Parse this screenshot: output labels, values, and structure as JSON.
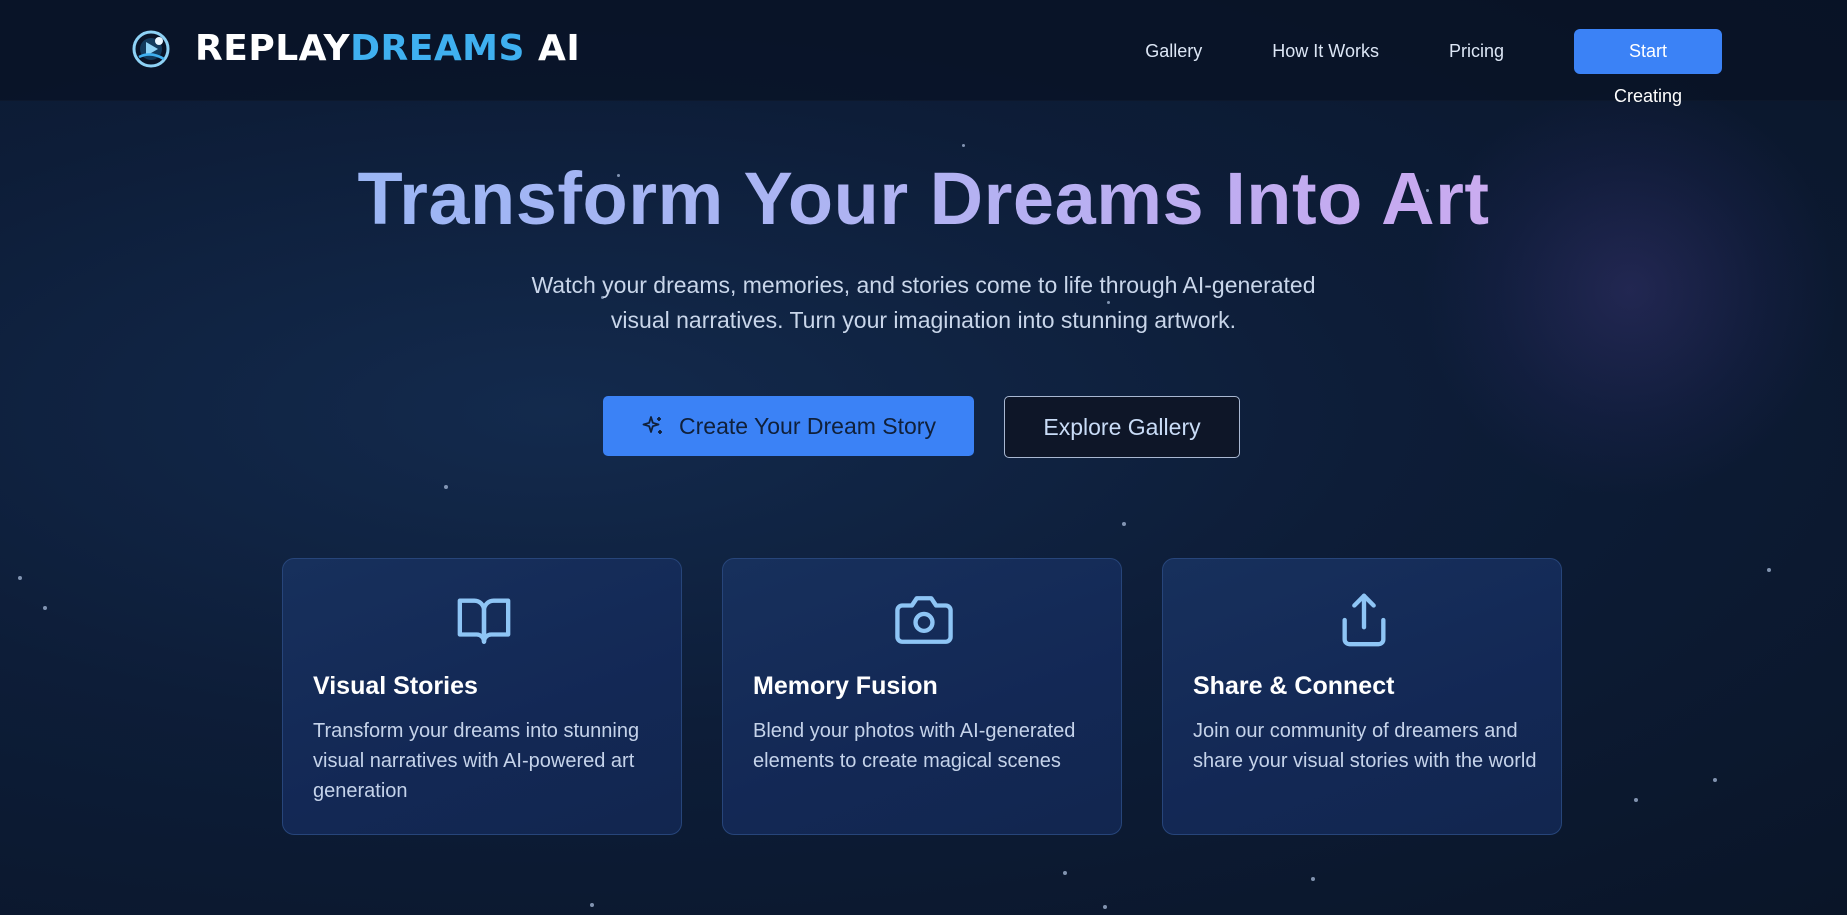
{
  "brand": {
    "part1": "REPLAY",
    "part2": "DREAMS",
    "part3": " AI"
  },
  "nav": {
    "items": [
      "Gallery",
      "How It Works",
      "Pricing"
    ],
    "cta": "Start Creating"
  },
  "hero": {
    "title": "Transform Your Dreams Into Art",
    "subtitle": "Watch your dreams, memories, and stories come to life through AI-generated visual narratives. Turn your imagination into stunning artwork.",
    "primary_button": "Create Your Dream Story",
    "secondary_button": "Explore Gallery"
  },
  "features": [
    {
      "icon": "book-open-icon",
      "title": "Visual Stories",
      "text": "Transform your dreams into stunning visual narratives with AI-powered art generation"
    },
    {
      "icon": "camera-icon",
      "title": "Memory Fusion",
      "text": "Blend your photos with AI-generated elements to create magical scenes"
    },
    {
      "icon": "share-icon",
      "title": "Share & Connect",
      "text": "Join our community of dreamers and share your visual stories with the world"
    }
  ],
  "colors": {
    "accent": "#3b82f6",
    "brand_blue": "#3fb0f0",
    "icon_blue": "#8ec5f5",
    "card_bg": "#152c58"
  }
}
